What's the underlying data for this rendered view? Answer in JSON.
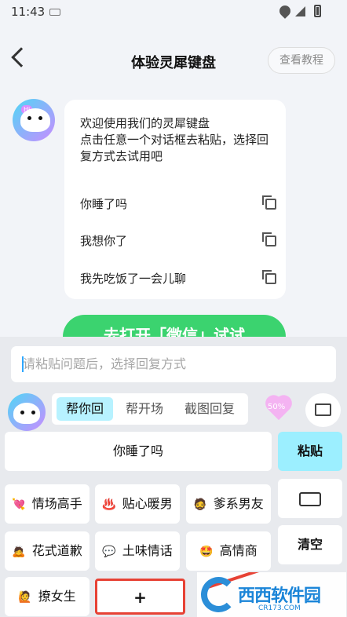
{
  "status": {
    "time": "11:43"
  },
  "header": {
    "title": "体验灵犀键盘",
    "tutorial": "查看教程"
  },
  "chat": {
    "intro": "欢迎使用我们的灵犀键盘\n点击任意一个对话框去粘贴，选择回复方式去试用吧",
    "messages": [
      "你睡了吗",
      "我想你了",
      "我先吃饭了一会儿聊"
    ]
  },
  "green_button": "去打开「微信」试试",
  "keyboard": {
    "paste_placeholder": "请粘贴问题后，选择回复方式",
    "tabs": [
      "帮你回",
      "帮开场",
      "截图回复"
    ],
    "heart_text": "50%",
    "suggestion": "你睡了吗",
    "paste": "粘贴",
    "categories": [
      {
        "emoji": "💘",
        "label": "情场高手"
      },
      {
        "emoji": "♨️",
        "label": "贴心暖男"
      },
      {
        "emoji": "🧔",
        "label": "爹系男友"
      },
      {
        "emoji": "🙇",
        "label": "花式道歉"
      },
      {
        "emoji": "💬",
        "label": "土味情话"
      },
      {
        "emoji": "🤩",
        "label": "高情商"
      },
      {
        "emoji": "🙋",
        "label": "撩女生"
      }
    ],
    "clear": "清空",
    "plus": "+",
    "watermark": "西西软件园",
    "watermark_sub": "CR173.COM"
  }
}
